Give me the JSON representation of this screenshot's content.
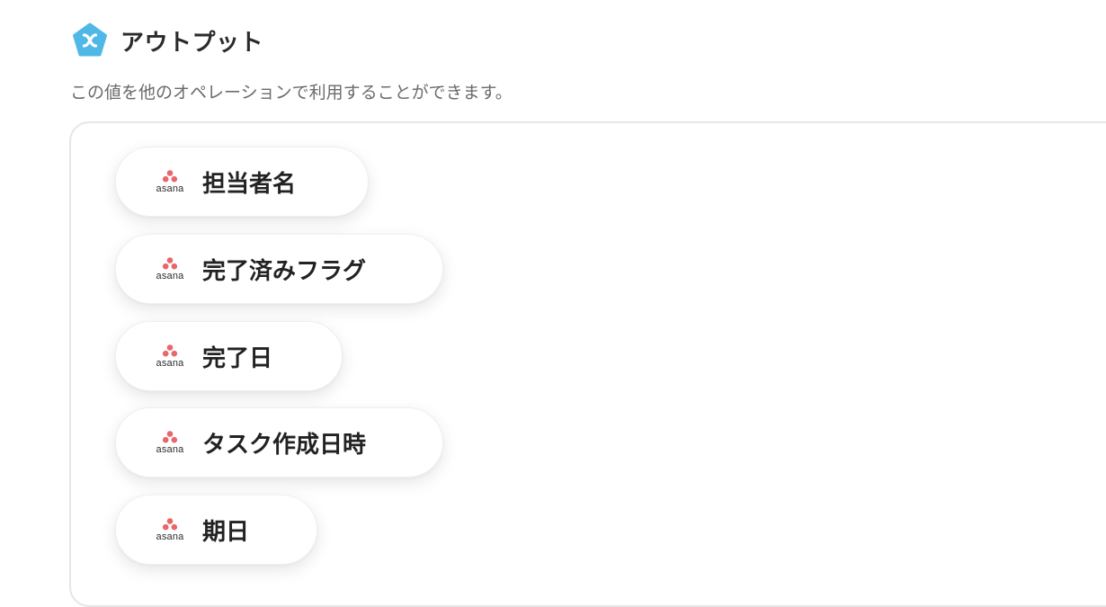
{
  "header": {
    "title": "アウトプット",
    "icon": "yoom-x-pentagon-icon",
    "icon_color": "#4fb8e6"
  },
  "subtitle": "この値を他のオペレーションで利用することができます。",
  "brand": {
    "name": "asana",
    "dot_color": "#e8676b"
  },
  "outputs": [
    {
      "label": "担当者名"
    },
    {
      "label": "完了済みフラグ"
    },
    {
      "label": "完了日"
    },
    {
      "label": "タスク作成日時"
    },
    {
      "label": "期日"
    }
  ]
}
